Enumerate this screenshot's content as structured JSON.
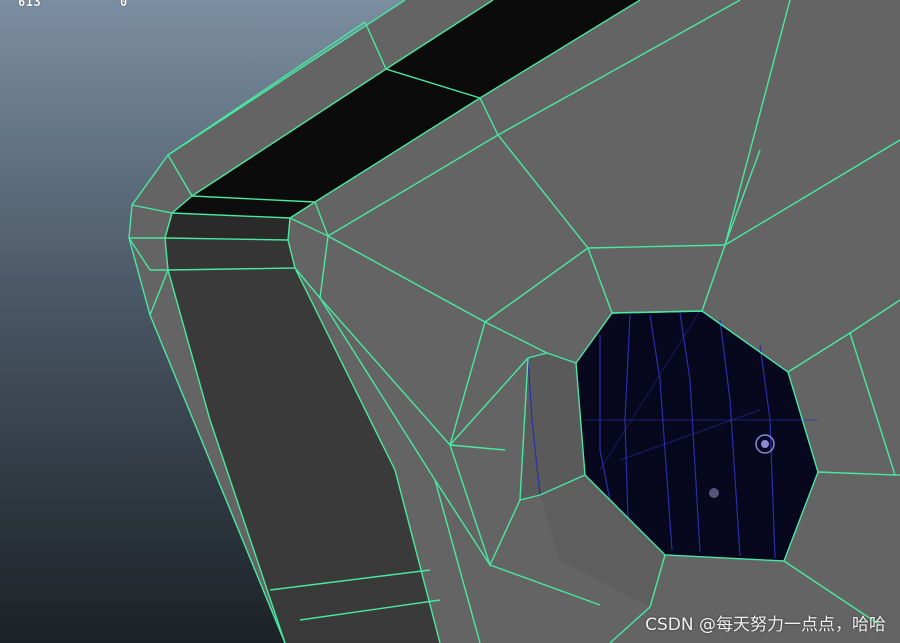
{
  "viewport": {
    "hud_left": "613",
    "hud_right": "0"
  },
  "watermark": {
    "text": "CSDN @每天努力一点点，哈哈"
  },
  "colors": {
    "background_top": "#7b8ea1",
    "background_bottom": "#1b2126",
    "face_gray": "#646464",
    "dark_face": "#3a3a3a",
    "black_face": "#0b0b0b",
    "wire_green": "#49e8a0",
    "inner_blue": "#2a2fa8",
    "hole_fill": "#07071e"
  },
  "icons": {
    "cylinder_marker": "cylinder-cap-icon",
    "pivot_marker": "pivot-icon"
  }
}
